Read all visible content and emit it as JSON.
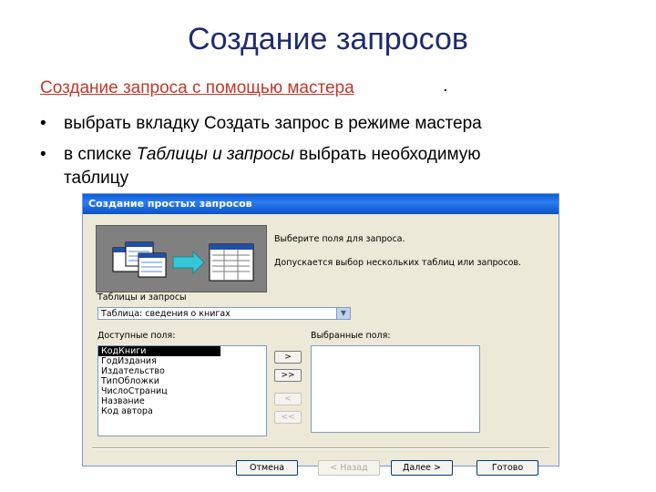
{
  "slide": {
    "title": "Создание запросов",
    "subtitle": "Создание запроса с помощью мастера",
    "subtitle_end": ".",
    "bullets": [
      {
        "mark": "•",
        "text": "выбрать вкладку Создать запрос в режиме мастера"
      },
      {
        "mark": "•",
        "pre": "в списке ",
        "em": "Таблицы и запросы",
        "post": " выбрать необходимую"
      }
    ],
    "bullet_continuation": "таблицу"
  },
  "dialog": {
    "title": "Создание простых запросов",
    "hint1": "Выберите поля для запроса.",
    "hint2": "Допускается выбор нескольких таблиц или запросов.",
    "tables_label": "Таблицы и запросы",
    "table_value": "Таблица: сведения о книгах",
    "available_label": "Доступные поля:",
    "selected_label": "Выбранные поля:",
    "available_fields": [
      "КодКниги",
      "ГодИздания",
      "Издательство",
      "ТипОбложки",
      "ЧислоСтраниц",
      "Название",
      "Код автора"
    ],
    "move_buttons": [
      ">",
      ">>",
      "<",
      "<<"
    ],
    "footer": {
      "cancel": "Отмена",
      "back": "< Назад",
      "next": "Далее >",
      "finish": "Готово"
    }
  },
  "colors": {
    "title": "#1f2c6e",
    "subtitle": "#c0392b",
    "dialog_bg": "#ece9d8",
    "titlebar": "#0a5fd8"
  }
}
